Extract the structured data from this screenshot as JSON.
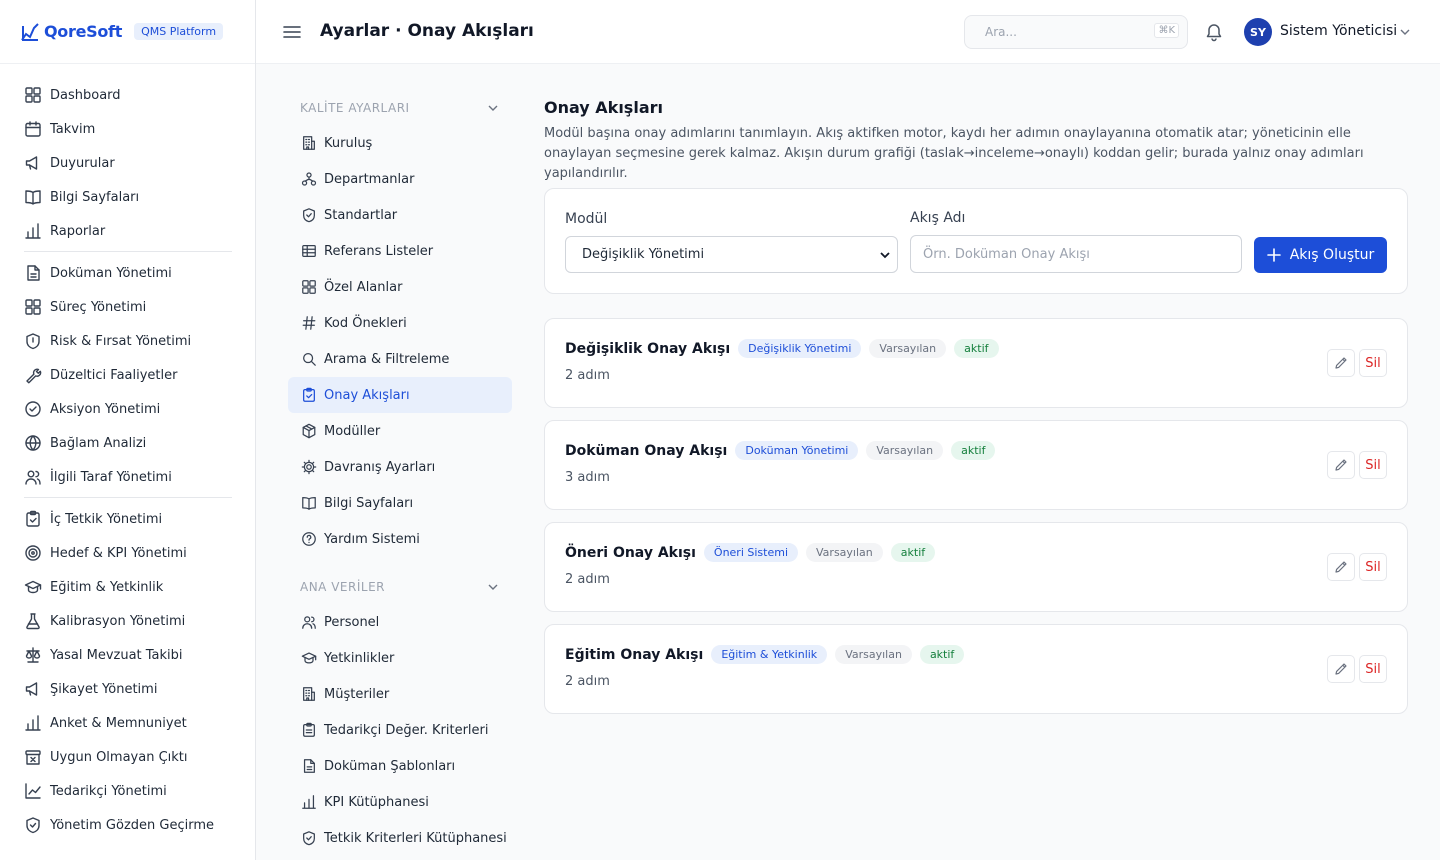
{
  "brand": {
    "name": "QoreSoft",
    "platform": "QMS Platform",
    "accent": "#1d4ed8"
  },
  "header": {
    "title": "Ayarlar · Onay Akışları",
    "search_placeholder": "Ara...",
    "search_shortcut": "⌘K",
    "user_initials": "SY",
    "user_name": "Sistem Yöneticisi"
  },
  "sidebar": {
    "groups": [
      [
        {
          "label": "Dashboard",
          "icon": "grid-icon"
        },
        {
          "label": "Takvim",
          "icon": "calendar-icon"
        },
        {
          "label": "Duyurular",
          "icon": "megaphone-icon"
        },
        {
          "label": "Bilgi Sayfaları",
          "icon": "book-icon"
        },
        {
          "label": "Raporlar",
          "icon": "bar-chart-icon"
        }
      ],
      [
        {
          "label": "Doküman Yönetimi",
          "icon": "document-icon"
        },
        {
          "label": "Süreç Yönetimi",
          "icon": "grid-icon"
        },
        {
          "label": "Risk & Fırsat Yönetimi",
          "icon": "shield-icon"
        },
        {
          "label": "Düzeltici Faaliyetler",
          "icon": "wrench-icon"
        },
        {
          "label": "Aksiyon Yönetimi",
          "icon": "check-circle-icon"
        },
        {
          "label": "Bağlam Analizi",
          "icon": "globe-icon"
        },
        {
          "label": "İlgili Taraf Yönetimi",
          "icon": "users-icon"
        }
      ],
      [
        {
          "label": "İç Tetkik Yönetimi",
          "icon": "clipboard-check-icon"
        },
        {
          "label": "Hedef & KPI Yönetimi",
          "icon": "target-icon"
        },
        {
          "label": "Eğitim & Yetkinlik",
          "icon": "graduation-cap-icon"
        },
        {
          "label": "Kalibrasyon Yönetimi",
          "icon": "flask-icon"
        },
        {
          "label": "Yasal Mevzuat Takibi",
          "icon": "scale-icon"
        },
        {
          "label": "Şikayet Yönetimi",
          "icon": "megaphone-icon"
        },
        {
          "label": "Anket & Memnuniyet",
          "icon": "bar-chart-icon"
        },
        {
          "label": "Uygun Olmayan Çıktı",
          "icon": "archive-x-icon"
        },
        {
          "label": "Tedarikçi Yönetimi",
          "icon": "line-chart-icon"
        },
        {
          "label": "Yönetim Gözden Geçirme",
          "icon": "shield-check-icon"
        }
      ]
    ]
  },
  "settings_nav": {
    "sections": [
      {
        "title": "KALİTE AYARLARI",
        "items": [
          {
            "label": "Kuruluş",
            "icon": "building-icon",
            "active": false
          },
          {
            "label": "Departmanlar",
            "icon": "org-chart-icon",
            "active": false
          },
          {
            "label": "Standartlar",
            "icon": "shield-check-icon",
            "active": false
          },
          {
            "label": "Referans Listeler",
            "icon": "table-icon",
            "active": false
          },
          {
            "label": "Özel Alanlar",
            "icon": "grid-icon",
            "active": false
          },
          {
            "label": "Kod Önekleri",
            "icon": "hash-icon",
            "active": false
          },
          {
            "label": "Arama & Filtreleme",
            "icon": "search-icon",
            "active": false
          },
          {
            "label": "Onay Akışları",
            "icon": "clipboard-check-icon",
            "active": true
          },
          {
            "label": "Modüller",
            "icon": "package-icon",
            "active": false
          },
          {
            "label": "Davranış Ayarları",
            "icon": "gear-icon",
            "active": false
          },
          {
            "label": "Bilgi Sayfaları",
            "icon": "book-icon",
            "active": false
          },
          {
            "label": "Yardım Sistemi",
            "icon": "help-circle-icon",
            "active": false
          }
        ]
      },
      {
        "title": "ANA VERİLER",
        "items": [
          {
            "label": "Personel",
            "icon": "users-icon",
            "active": false
          },
          {
            "label": "Yetkinlikler",
            "icon": "graduation-cap-icon",
            "active": false
          },
          {
            "label": "Müşteriler",
            "icon": "building-icon",
            "active": false
          },
          {
            "label": "Tedarikçi Değer. Kriterleri",
            "icon": "clipboard-icon",
            "active": false
          },
          {
            "label": "Doküman Şablonları",
            "icon": "document-icon",
            "active": false
          },
          {
            "label": "KPI Kütüphanesi",
            "icon": "bar-chart-icon",
            "active": false
          },
          {
            "label": "Tetkik Kriterleri Kütüphanesi",
            "icon": "shield-check-icon",
            "active": false
          }
        ]
      }
    ]
  },
  "main": {
    "title": "Onay Akışları",
    "description": "Modül başına onay adımlarını tanımlayın. Akış aktifken motor, kaydı her adımın onaylayanına otomatik atar; yöneticinin elle onaylayan seçmesine gerek kalmaz. Akışın durum grafiği (taslak→inceleme→onaylı) koddan gelir; burada yalnız onay adımları yapılandırılır.",
    "form": {
      "module_label": "Modül",
      "module_value": "Değişiklik Yönetimi",
      "name_label": "Akış Adı",
      "name_placeholder": "Örn. Doküman Onay Akışı",
      "create_label": "Akış Oluştur"
    },
    "delete_label": "Sil",
    "flows": [
      {
        "name": "Değişiklik Onay Akışı",
        "module": "Değişiklik Yönetimi",
        "default_label": "Varsayılan",
        "status": "aktif",
        "steps": "2 adım"
      },
      {
        "name": "Doküman Onay Akışı",
        "module": "Doküman Yönetimi",
        "default_label": "Varsayılan",
        "status": "aktif",
        "steps": "3 adım"
      },
      {
        "name": "Öneri Onay Akışı",
        "module": "Öneri Sistemi",
        "default_label": "Varsayılan",
        "status": "aktif",
        "steps": "2 adım"
      },
      {
        "name": "Eğitim Onay Akışı",
        "module": "Eğitim & Yetkinlik",
        "default_label": "Varsayılan",
        "status": "aktif",
        "steps": "2 adım"
      }
    ]
  }
}
